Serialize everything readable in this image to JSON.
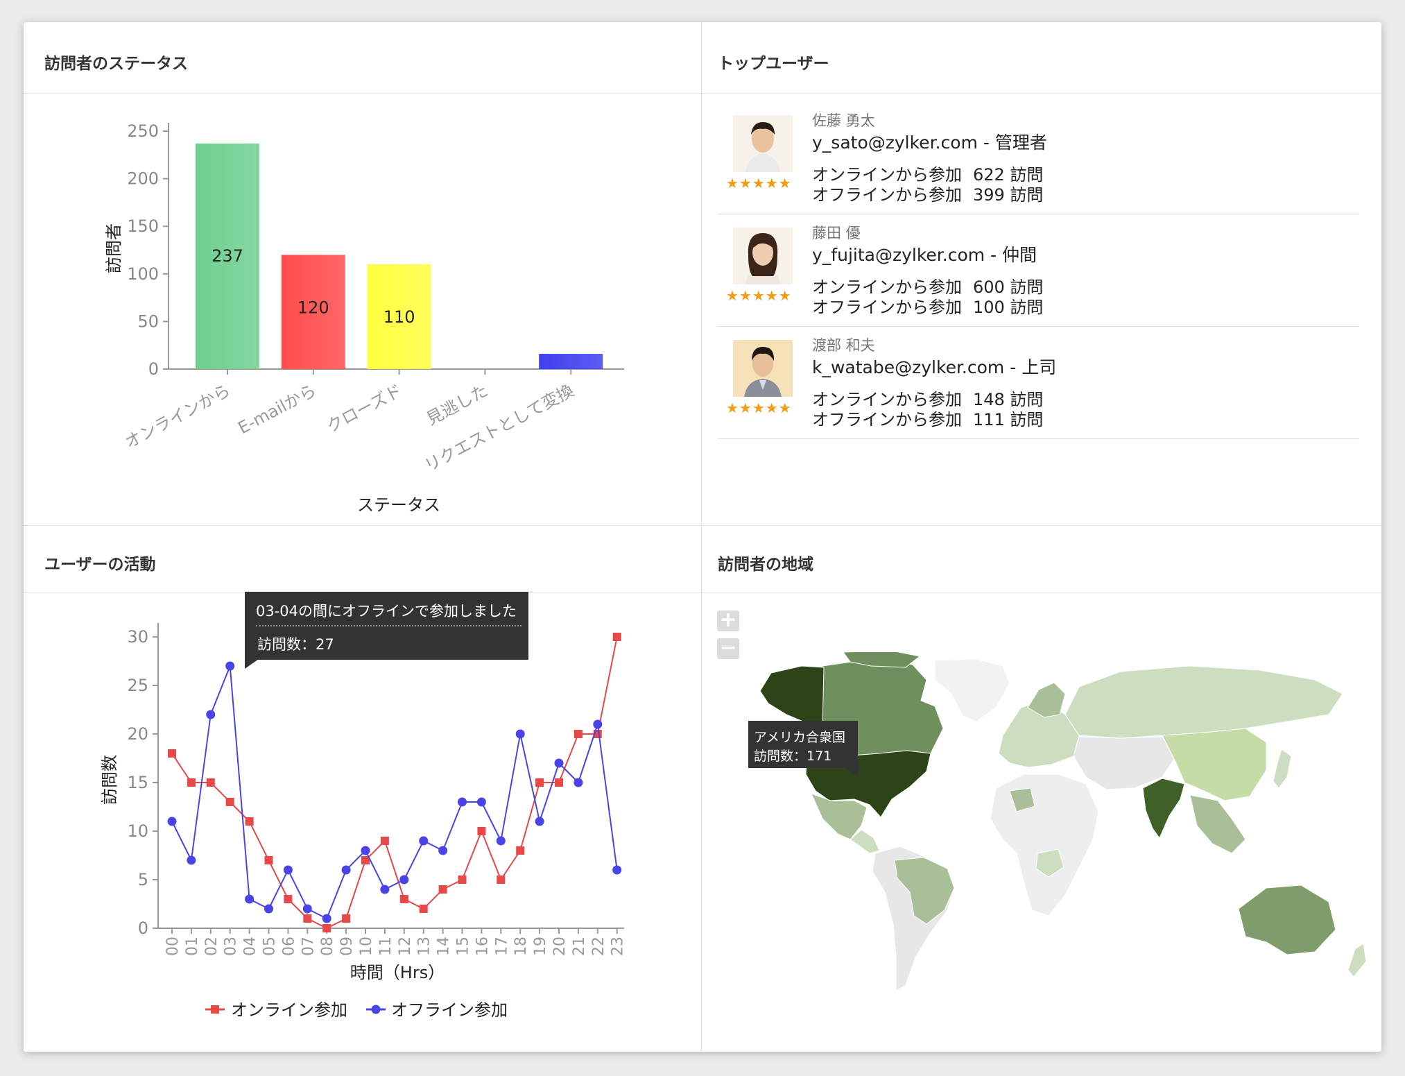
{
  "colors": {
    "green": "#6fcf8f",
    "red": "#ff4c4c",
    "yellow": "#ffff40",
    "blue": "#4040f0",
    "online": "#e84848",
    "offline": "#4a44e8",
    "star": "#f39c12"
  },
  "panels": {
    "status_title": "訪問者のステータス",
    "top_users_title": "トップユーザー",
    "activity_title": "ユーザーの活動",
    "region_title": "訪問者の地域"
  },
  "top_users": [
    {
      "name": "佐藤 勇太",
      "email": "y_sato@zylker.com",
      "role": " - 管理者",
      "online_label": "オンラインから参加",
      "online": "622 訪問",
      "offline_label": "オフラインから参加",
      "offline": "399 訪問",
      "stars": "★★★★★"
    },
    {
      "name": "藤田 優",
      "email": "y_fujita@zylker.com",
      "role": " - 仲間",
      "online_label": "オンラインから参加",
      "online": "600 訪問",
      "offline_label": "オフラインから参加",
      "offline": "100 訪問",
      "stars": "★★★★★"
    },
    {
      "name": "渡部 和夫",
      "email": "k_watabe@zylker.com",
      "role": " - 上司",
      "online_label": "オンラインから参加",
      "online": "148 訪問",
      "offline_label": "オフラインから参加",
      "offline": "111 訪問",
      "stars": "★★★★★"
    }
  ],
  "activity_tooltip": {
    "title": "03-04の間にオフラインで参加しました",
    "value": "訪問数：27"
  },
  "map": {
    "zoom_in": "+",
    "zoom_out": "−",
    "tooltip_country": "アメリカ合衆国",
    "tooltip_value": "訪問数：171"
  },
  "chart_data": [
    {
      "type": "bar",
      "categories": [
        "オンラインから",
        "E-mailから",
        "クローズド",
        "見逃した",
        "リクエストとして変換"
      ],
      "values": [
        237,
        120,
        110,
        0,
        16
      ],
      "data_labels": [
        "237",
        "120",
        "110",
        "",
        ""
      ],
      "xlabel": "ステータス",
      "ylabel": "訪問者",
      "ylim": [
        0,
        250
      ],
      "yticks": [
        0,
        50,
        100,
        150,
        200,
        250
      ]
    },
    {
      "type": "line",
      "x": [
        "00",
        "01",
        "02",
        "03",
        "04",
        "05",
        "06",
        "07",
        "08",
        "09",
        "10",
        "11",
        "12",
        "13",
        "14",
        "15",
        "16",
        "17",
        "18",
        "19",
        "20",
        "21",
        "22",
        "23"
      ],
      "series": [
        {
          "name": "オンライン参加",
          "values": [
            18,
            15,
            15,
            13,
            11,
            7,
            3,
            1,
            0,
            1,
            7,
            9,
            3,
            2,
            4,
            5,
            10,
            5,
            8,
            15,
            15,
            20,
            20,
            30
          ]
        },
        {
          "name": "オフライン参加",
          "values": [
            11,
            7,
            22,
            27,
            3,
            2,
            6,
            2,
            1,
            6,
            8,
            4,
            5,
            9,
            8,
            13,
            13,
            9,
            20,
            11,
            17,
            15,
            21,
            6
          ]
        }
      ],
      "xlabel": "時間（Hrs）",
      "ylabel": "訪問数",
      "ylim": [
        0,
        30
      ],
      "yticks": [
        0,
        5,
        10,
        15,
        20,
        25,
        30
      ],
      "legend": "bottom"
    }
  ]
}
